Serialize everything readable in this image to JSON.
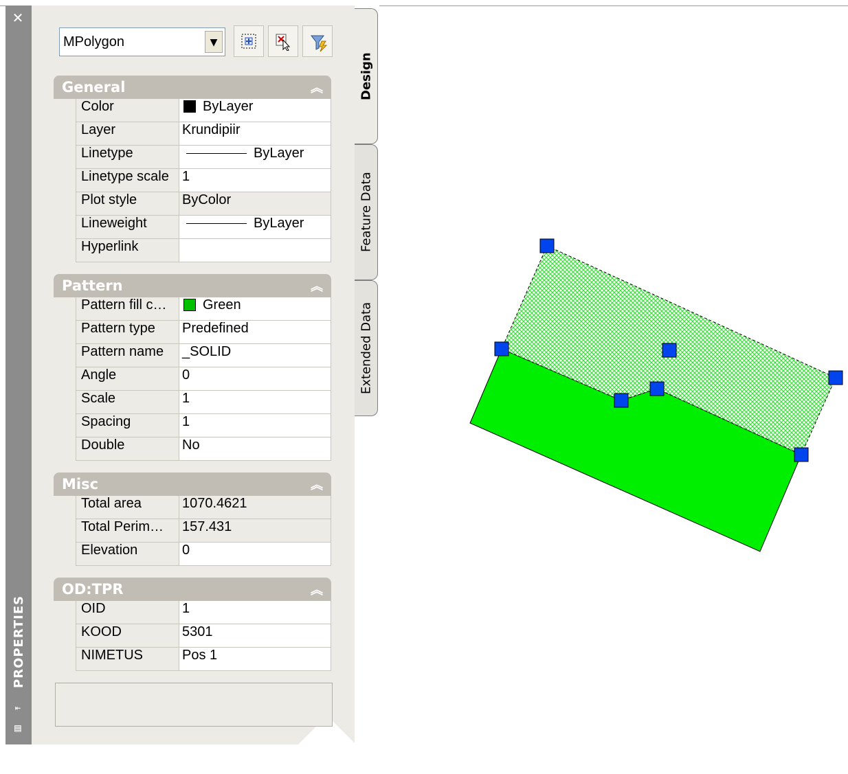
{
  "palette": {
    "title": "PROPERTIES",
    "close_icon": "close-icon",
    "object_type": "MPolygon",
    "tabs": [
      "Design",
      "Feature Data",
      "Extended Data"
    ],
    "active_tab": "Design",
    "toolbar_icons": [
      "quick-select-icon",
      "select-objects-icon",
      "toggle-pickadd-icon"
    ]
  },
  "sections": {
    "general": {
      "title": "General",
      "rows": [
        {
          "label": "Color",
          "value": "ByLayer",
          "swatch": "#000000"
        },
        {
          "label": "Layer",
          "value": "Krundipiir"
        },
        {
          "label": "Linetype",
          "value": "ByLayer"
        },
        {
          "label": "Linetype scale",
          "value": "1"
        },
        {
          "label": "Plot style",
          "value": "ByColor"
        },
        {
          "label": "Lineweight",
          "value": "ByLayer"
        },
        {
          "label": "Hyperlink",
          "value": ""
        }
      ]
    },
    "pattern": {
      "title": "Pattern",
      "rows": [
        {
          "label": "Pattern fill c…",
          "value": "Green",
          "swatch": "#00c000"
        },
        {
          "label": "Pattern type",
          "value": "Predefined"
        },
        {
          "label": "Pattern name",
          "value": "_SOLID"
        },
        {
          "label": "Angle",
          "value": "0"
        },
        {
          "label": "Scale",
          "value": "1"
        },
        {
          "label": "Spacing",
          "value": "1"
        },
        {
          "label": "Double",
          "value": "No"
        }
      ]
    },
    "misc": {
      "title": "Misc",
      "rows": [
        {
          "label": "Total area",
          "value": "1070.4621"
        },
        {
          "label": "Total Perim…",
          "value": "157.431"
        },
        {
          "label": "Elevation",
          "value": "0"
        }
      ]
    },
    "od_tpr": {
      "title": "OD:TPR",
      "rows": [
        {
          "label": "OID",
          "value": "1"
        },
        {
          "label": "KOOD",
          "value": "5301"
        },
        {
          "label": "NIMETUS",
          "value": "Pos 1"
        }
      ]
    }
  },
  "drawing": {
    "fill_color": "#00ee00",
    "grip_color": "#0044ee",
    "selected_hatch": "light-green crosshatch"
  }
}
